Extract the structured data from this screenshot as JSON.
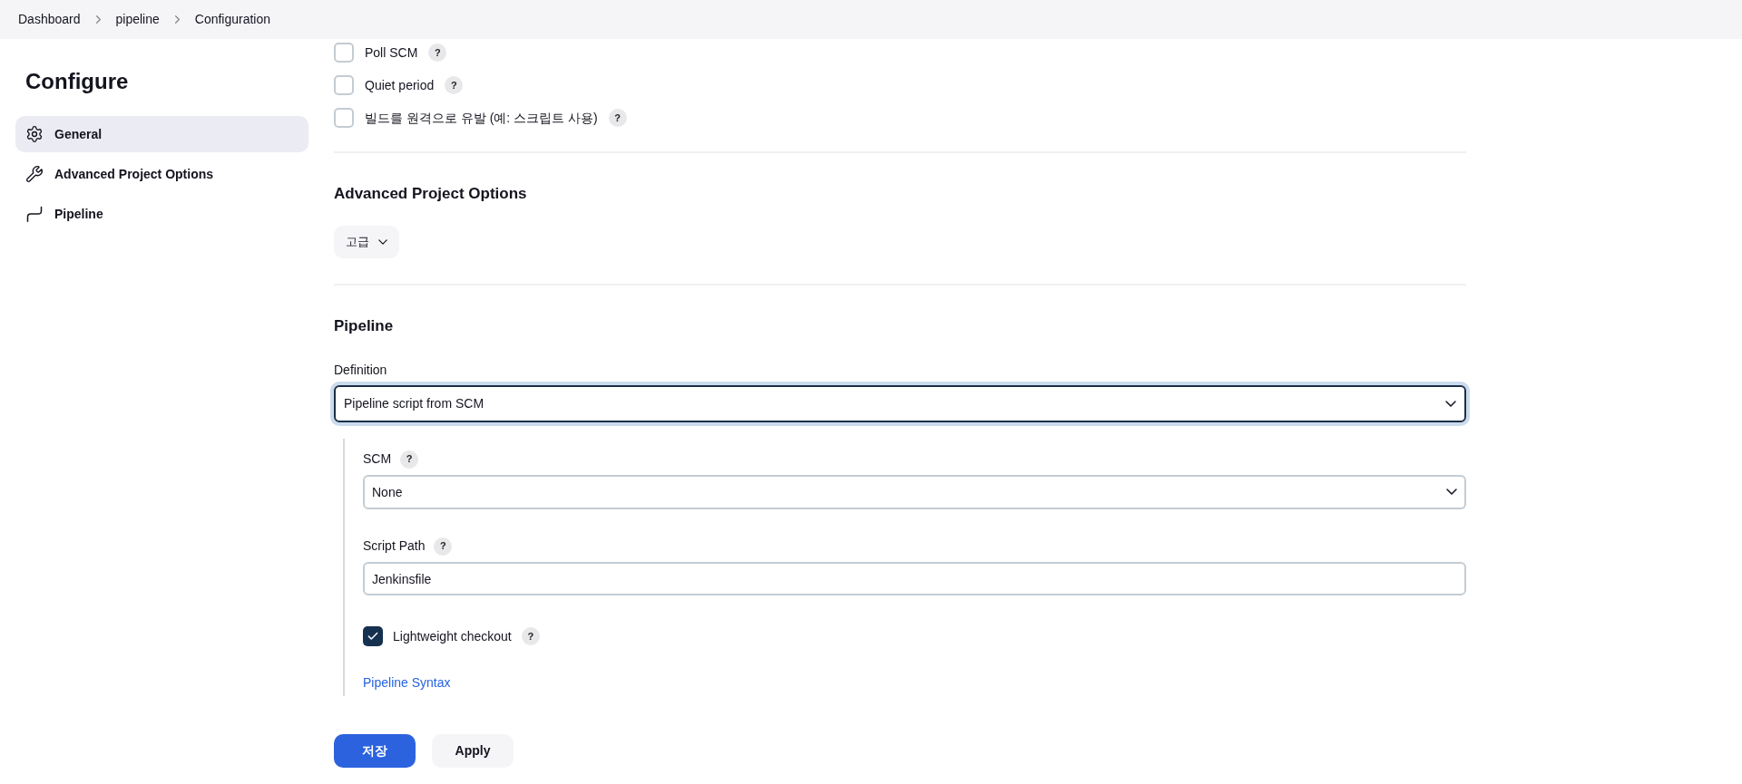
{
  "breadcrumbs": [
    "Dashboard",
    "pipeline",
    "Configuration"
  ],
  "sidebar": {
    "title": "Configure",
    "items": [
      {
        "label": "General",
        "selected": true
      },
      {
        "label": "Advanced Project Options",
        "selected": false
      },
      {
        "label": "Pipeline",
        "selected": false
      }
    ]
  },
  "triggers": [
    {
      "label": "Poll SCM",
      "checked": false
    },
    {
      "label": "Quiet period",
      "checked": false
    },
    {
      "label": "빌드를 원격으로 유발 (예: 스크립트 사용)",
      "checked": false
    }
  ],
  "help_mark": "?",
  "advanced": {
    "heading": "Advanced Project Options",
    "button": "고급"
  },
  "pipeline": {
    "heading": "Pipeline",
    "definition_label": "Definition",
    "definition_value": "Pipeline script from SCM",
    "scm_label": "SCM",
    "scm_value": "None",
    "script_path_label": "Script Path",
    "script_path_value": "Jenkinsfile",
    "lightweight": {
      "label": "Lightweight checkout",
      "checked": true
    },
    "syntax_link": "Pipeline Syntax"
  },
  "buttons": {
    "save": "저장",
    "apply": "Apply"
  }
}
